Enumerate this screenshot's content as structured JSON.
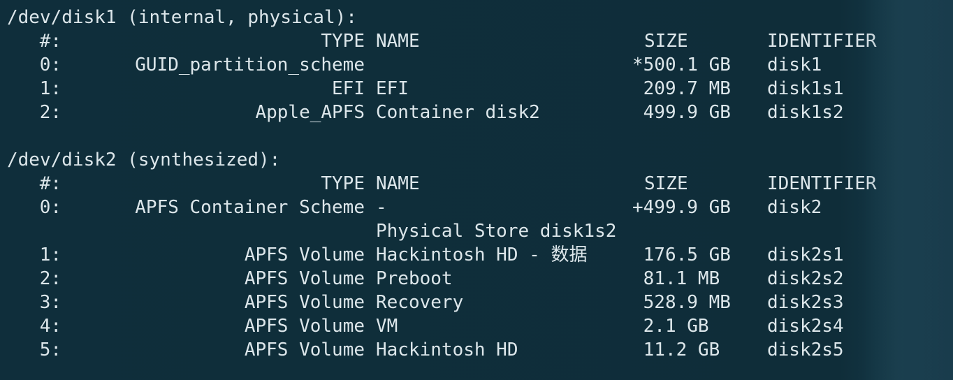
{
  "disk1": {
    "header": "/dev/disk1 (internal, physical):",
    "columns": {
      "index": "#:",
      "type": "TYPE",
      "name": "NAME",
      "size": "SIZE",
      "identifier": "IDENTIFIER"
    },
    "rows": [
      {
        "index": "0:",
        "type": "GUID_partition_scheme",
        "name": "",
        "size": "*500.1 GB",
        "identifier": "disk1"
      },
      {
        "index": "1:",
        "type": "EFI",
        "name": "EFI",
        "size": " 209.7 MB",
        "identifier": "disk1s1"
      },
      {
        "index": "2:",
        "type": "Apple_APFS",
        "name": "Container disk2",
        "size": " 499.9 GB",
        "identifier": "disk1s2"
      }
    ]
  },
  "disk2": {
    "header": "/dev/disk2 (synthesized):",
    "columns": {
      "index": "#:",
      "type": "TYPE",
      "name": "NAME",
      "size": "SIZE",
      "identifier": "IDENTIFIER"
    },
    "rows": [
      {
        "index": "0:",
        "type": "APFS Container Scheme",
        "name": "-",
        "size": "+499.9 GB",
        "identifier": "disk2"
      },
      {
        "index": "",
        "type": "",
        "name": "Physical Store disk1s2",
        "size": "",
        "identifier": ""
      },
      {
        "index": "1:",
        "type": "APFS Volume",
        "name": "Hackintosh HD - 数据",
        "size": " 176.5 GB",
        "identifier": "disk2s1"
      },
      {
        "index": "2:",
        "type": "APFS Volume",
        "name": "Preboot",
        "size": " 81.1 MB",
        "identifier": "disk2s2"
      },
      {
        "index": "3:",
        "type": "APFS Volume",
        "name": "Recovery",
        "size": " 528.9 MB",
        "identifier": "disk2s3"
      },
      {
        "index": "4:",
        "type": "APFS Volume",
        "name": "VM",
        "size": " 2.1 GB",
        "identifier": "disk2s4"
      },
      {
        "index": "5:",
        "type": "APFS Volume",
        "name": "Hackintosh HD",
        "size": " 11.2 GB",
        "identifier": "disk2s5"
      }
    ]
  },
  "colors": {
    "background": "#0f2d3a",
    "text": "#dce6ea"
  }
}
